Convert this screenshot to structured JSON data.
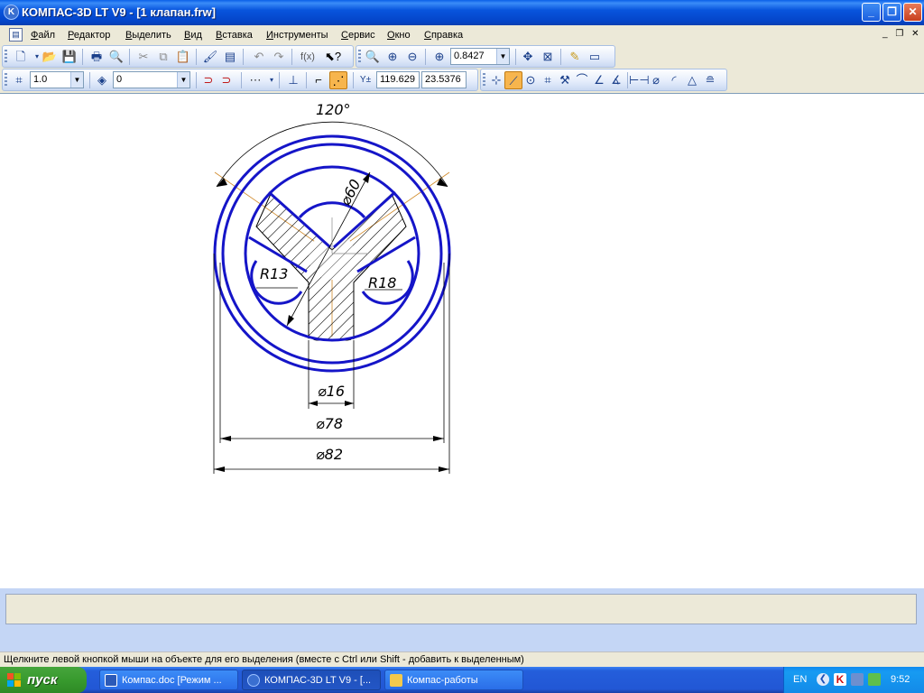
{
  "window": {
    "title": "КОМПАС-3D LT V9 - [1 клапан.frw]",
    "app_icon": "K"
  },
  "window_buttons": {
    "minimize": "_",
    "restore": "❐",
    "close": "✕"
  },
  "menu": {
    "items": [
      {
        "first": "Ф",
        "rest": "айл"
      },
      {
        "first": "Р",
        "rest": "едактор"
      },
      {
        "first": "В",
        "rest": "ыделить"
      },
      {
        "first": "В",
        "rest": "ид"
      },
      {
        "first": "В",
        "rest": "ставка"
      },
      {
        "first": "И",
        "rest": "нструменты"
      },
      {
        "first": "С",
        "rest": "ервис"
      },
      {
        "first": "О",
        "rest": "кно"
      },
      {
        "first": "С",
        "rest": "правка"
      }
    ],
    "mdi_controls": "_ ❐ ✕"
  },
  "toolbar1": {
    "zoom_value": "0.8427",
    "fx_label": "f(x)"
  },
  "toolbar2": {
    "scale_value": "1.0",
    "layer_value": "0",
    "coord_x": "119.629",
    "coord_y": "23.5376"
  },
  "drawing": {
    "angle_label": "120°",
    "dim_phi60": "⌀60",
    "dim_r13": "R13",
    "dim_r18": "R18",
    "dim_phi16": "⌀16",
    "dim_phi78": "⌀78",
    "dim_phi82": "⌀82",
    "colors": {
      "contour": "#1515c8",
      "dimension": "#000000",
      "axis": "#d08a2a"
    }
  },
  "status": {
    "hint": "Щелкните левой кнопкой мыши на объекте для его выделения (вместе с Ctrl или Shift - добавить к выделенным)"
  },
  "taskbar": {
    "start_label": "пуск",
    "tasks": [
      {
        "label": "Компас.doc [Режим ...",
        "icon": "word-icon"
      },
      {
        "label": "КОМПАС-3D LT V9 - [...",
        "icon": "kompas-icon"
      },
      {
        "label": "Компас-работы",
        "icon": "folder-icon"
      }
    ],
    "language": "EN",
    "clock": "9:52"
  }
}
